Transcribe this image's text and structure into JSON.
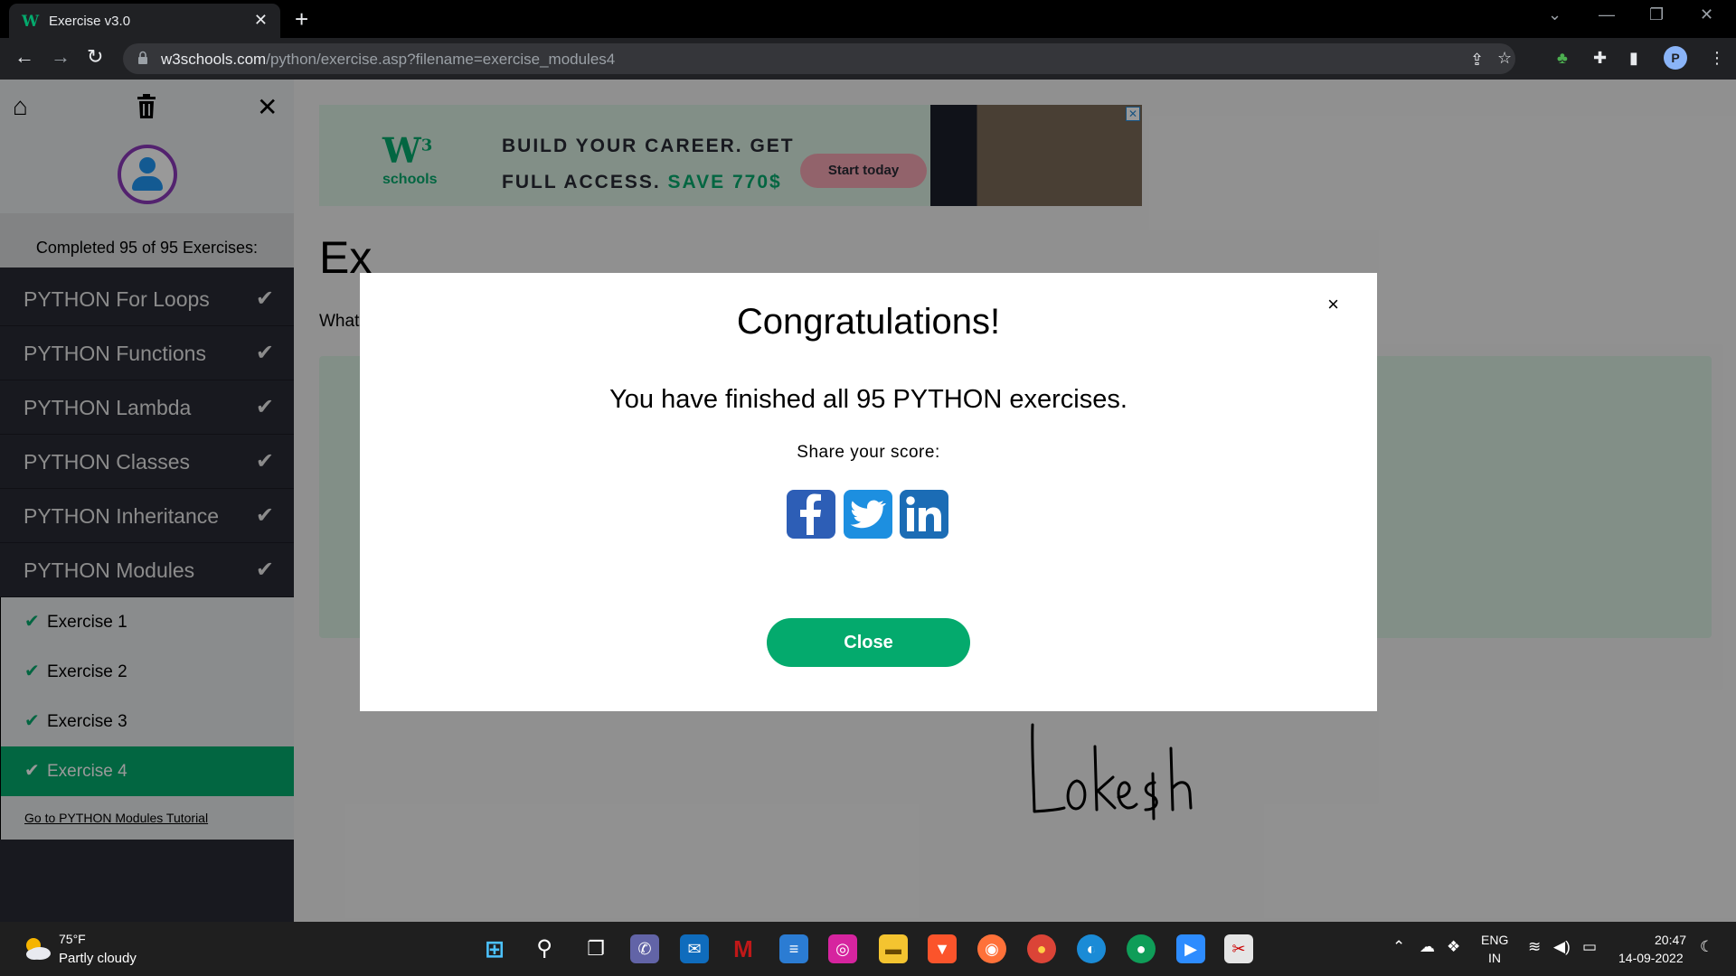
{
  "browser": {
    "tab_title": "Exercise v3.0",
    "url_host": "w3schools.com",
    "url_path": "/python/exercise.asp?filename=exercise_modules4",
    "profile_initial": "P"
  },
  "sidebar": {
    "progress_text": "Completed 95 of 95 Exercises:",
    "items": [
      {
        "label": "PYTHON For Loops"
      },
      {
        "label": "PYTHON Functions"
      },
      {
        "label": "PYTHON Lambda"
      },
      {
        "label": "PYTHON Classes"
      },
      {
        "label": "PYTHON Inheritance"
      },
      {
        "label": "PYTHON Modules"
      }
    ],
    "subitems": [
      {
        "label": "Exercise 1"
      },
      {
        "label": "Exercise 2"
      },
      {
        "label": "Exercise 3"
      },
      {
        "label": "Exercise 4"
      }
    ],
    "tutorial_link": "Go to PYTHON Modules Tutorial"
  },
  "ad": {
    "logo_text": "schools",
    "headline_1": "BUILD YOUR CAREER. GET",
    "headline_2": "FULL ACCESS.",
    "headline_save": "SAVE 770$",
    "cta": "Start today"
  },
  "main": {
    "heading_partial": "Ex",
    "question_partial": "What"
  },
  "modal": {
    "title": "Congratulations!",
    "message": "You have finished all 95 PYTHON exercises.",
    "share_label": "Share your score:",
    "close_label": "Close",
    "close_x": "×"
  },
  "signature": "Lokesh",
  "taskbar": {
    "temperature": "75°F",
    "weather": "Partly cloudy",
    "lang_1": "ENG",
    "lang_2": "IN",
    "time": "20:47",
    "date": "14-09-2022"
  },
  "colors": {
    "accent": "#04aa6d",
    "sidebar_dark": "#282a35",
    "overlay": "rgba(0,0,0,0.4)"
  }
}
